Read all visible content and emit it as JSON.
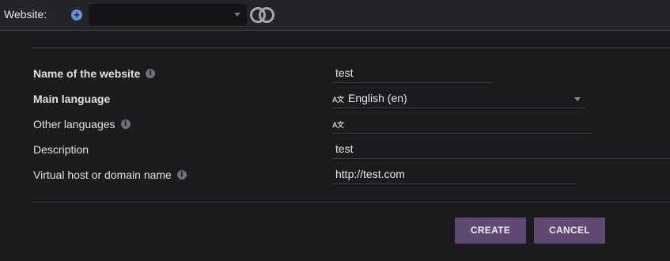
{
  "topbar": {
    "website_label": "Website:",
    "plus_symbol": "+",
    "website_select_value": ""
  },
  "form": {
    "name_label": "Name of the website",
    "name_value": "test",
    "main_language_label": "Main language",
    "main_language_value": "English (en)",
    "other_languages_label": "Other languages",
    "other_languages_value": "",
    "description_label": "Description",
    "description_value": "test",
    "vhost_label": "Virtual host or domain name",
    "vhost_value": "http://test.com",
    "info_symbol": "i",
    "language_icon_glyph": "A文"
  },
  "actions": {
    "create_label": "CREATE",
    "cancel_label": "CANCEL"
  },
  "colors": {
    "background": "#1c1c1f",
    "topbar": "#252529",
    "button": "#5e4a73",
    "accent_icon": "#6b8fd6"
  }
}
